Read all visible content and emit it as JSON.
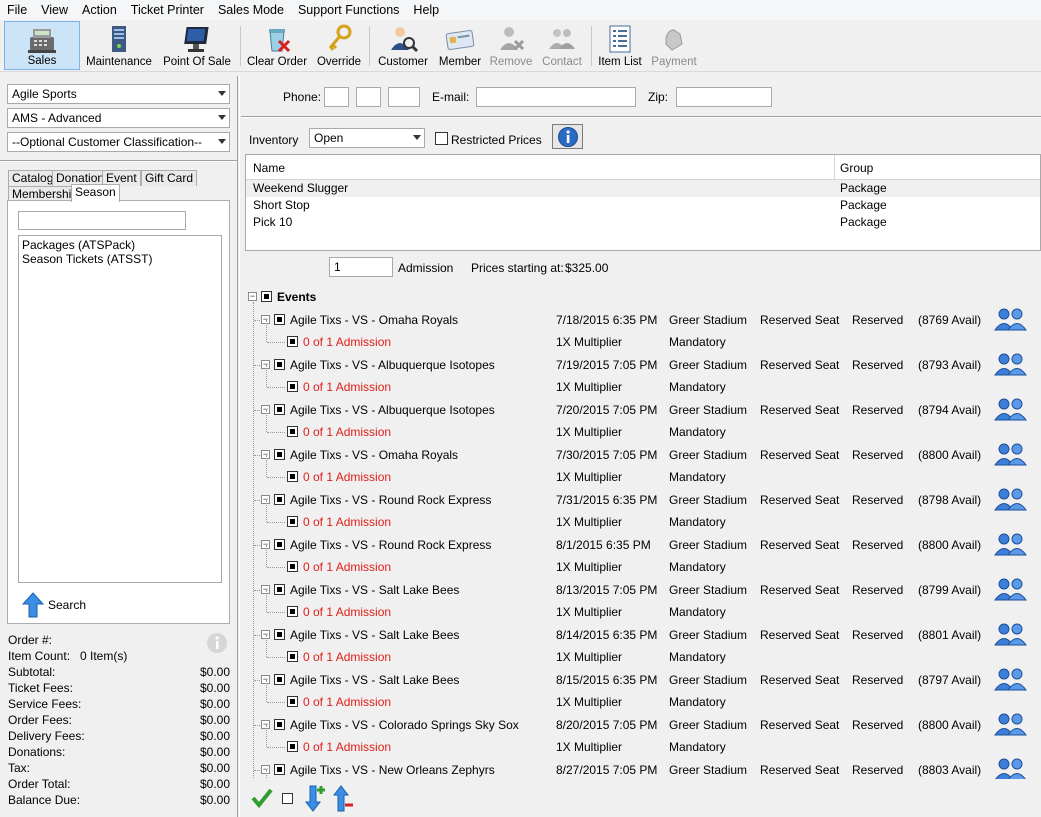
{
  "menu": [
    "File",
    "View",
    "Action",
    "Ticket Printer",
    "Sales Mode",
    "Support Functions",
    "Help"
  ],
  "toolbar": {
    "sales": "Sales",
    "maintenance": "Maintenance",
    "point_of_sale": "Point Of Sale",
    "clear_order": "Clear Order",
    "override": "Override",
    "customer": "Customer",
    "member": "Member",
    "remove": "Remove",
    "contact": "Contact",
    "item_list": "Item List",
    "payment": "Payment"
  },
  "left": {
    "org_combo": "Agile Sports",
    "mode_combo": "AMS - Advanced",
    "class_combo": "--Optional Customer Classification--",
    "tabs": [
      "Catalog",
      "Donation",
      "Event",
      "Gift Card",
      "Membership",
      "Season"
    ],
    "search_value": "",
    "list": [
      "Packages  (ATSPack)",
      "Season Tickets  (ATSST)"
    ],
    "search_button": "Search"
  },
  "totals": {
    "order_label": "Order #:",
    "order_value": "",
    "count_label": "Item Count:",
    "count_value": "0 Item(s)",
    "rows": [
      {
        "label": "Subtotal:",
        "value": "$0.00"
      },
      {
        "label": "Ticket Fees:",
        "value": "$0.00"
      },
      {
        "label": "Service Fees:",
        "value": "$0.00"
      },
      {
        "label": "Order Fees:",
        "value": "$0.00"
      },
      {
        "label": "Delivery Fees:",
        "value": "$0.00"
      },
      {
        "label": "Donations:",
        "value": "$0.00"
      },
      {
        "label": "Tax:",
        "value": "$0.00"
      },
      {
        "label": "Order Total:",
        "value": "$0.00"
      },
      {
        "label": "Balance Due:",
        "value": "$0.00"
      }
    ]
  },
  "customer": {
    "phone_label": "Phone:",
    "email_label": "E-mail:",
    "zip_label": "Zip:",
    "phone1": "",
    "phone2": "",
    "phone3": "",
    "email": "",
    "zip": ""
  },
  "inventory": {
    "label": "Inventory",
    "value": "Open",
    "restricted_label": "Restricted Prices"
  },
  "grid": {
    "col_name": "Name",
    "col_group": "Group",
    "rows": [
      {
        "name": "Weekend Slugger",
        "group": "Package"
      },
      {
        "name": "Short Stop",
        "group": "Package"
      },
      {
        "name": "Pick 10",
        "group": "Package"
      }
    ]
  },
  "qty": {
    "value": "1",
    "label": "Admission",
    "price_label": "Prices starting at:",
    "price_value": "$325.00"
  },
  "events": {
    "header": "Events",
    "admission_text": "0 of 1 Admission",
    "multiplier": "1X Multiplier",
    "mandatory": "Mandatory",
    "items": [
      {
        "name": "Agile Tixs - VS - Omaha Royals",
        "date": "7/18/2015 6:35 PM",
        "venue": "Greer Stadium",
        "seat": "Reserved Seat",
        "type": "Reserved",
        "avail": "(8769 Avail)"
      },
      {
        "name": "Agile Tixs - VS - Albuquerque Isotopes",
        "date": "7/19/2015 7:05 PM",
        "venue": "Greer Stadium",
        "seat": "Reserved Seat",
        "type": "Reserved",
        "avail": "(8793 Avail)"
      },
      {
        "name": "Agile Tixs - VS - Albuquerque Isotopes",
        "date": "7/20/2015 7:05 PM",
        "venue": "Greer Stadium",
        "seat": "Reserved Seat",
        "type": "Reserved",
        "avail": "(8794 Avail)"
      },
      {
        "name": "Agile Tixs - VS - Omaha Royals",
        "date": "7/30/2015 7:05 PM",
        "venue": "Greer Stadium",
        "seat": "Reserved Seat",
        "type": "Reserved",
        "avail": "(8800 Avail)"
      },
      {
        "name": "Agile Tixs - VS - Round Rock Express",
        "date": "7/31/2015 6:35 PM",
        "venue": "Greer Stadium",
        "seat": "Reserved Seat",
        "type": "Reserved",
        "avail": "(8798 Avail)"
      },
      {
        "name": "Agile Tixs - VS - Round Rock Express",
        "date": "8/1/2015 6:35 PM",
        "venue": "Greer Stadium",
        "seat": "Reserved Seat",
        "type": "Reserved",
        "avail": "(8800 Avail)"
      },
      {
        "name": "Agile Tixs - VS - Salt Lake Bees",
        "date": "8/13/2015 7:05 PM",
        "venue": "Greer Stadium",
        "seat": "Reserved Seat",
        "type": "Reserved",
        "avail": "(8799 Avail)"
      },
      {
        "name": "Agile Tixs - VS - Salt Lake Bees",
        "date": "8/14/2015 6:35 PM",
        "venue": "Greer Stadium",
        "seat": "Reserved Seat",
        "type": "Reserved",
        "avail": "(8801 Avail)"
      },
      {
        "name": "Agile Tixs - VS - Salt Lake Bees",
        "date": "8/15/2015 6:35 PM",
        "venue": "Greer Stadium",
        "seat": "Reserved Seat",
        "type": "Reserved",
        "avail": "(8797 Avail)"
      },
      {
        "name": "Agile Tixs - VS - Colorado Springs Sky Sox",
        "date": "8/20/2015 7:05 PM",
        "venue": "Greer Stadium",
        "seat": "Reserved Seat",
        "type": "Reserved",
        "avail": "(8800 Avail)"
      },
      {
        "name": "Agile Tixs - VS - New Orleans Zephyrs",
        "date": "8/27/2015 7:05 PM",
        "venue": "Greer Stadium",
        "seat": "Reserved Seat",
        "type": "Reserved",
        "avail": "(8803 Avail)"
      }
    ]
  }
}
